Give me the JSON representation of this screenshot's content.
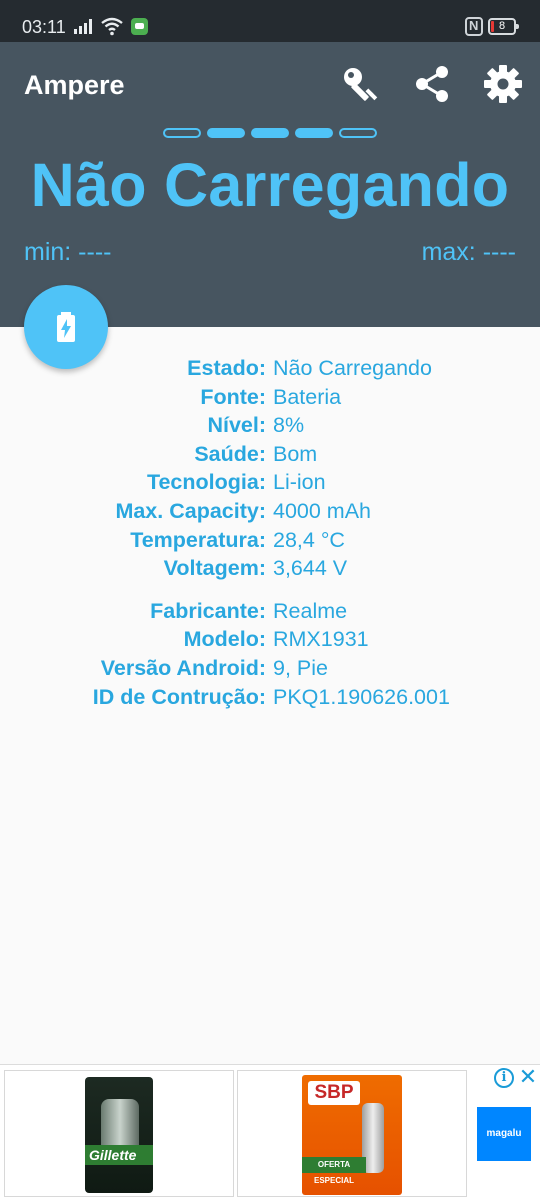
{
  "statusbar": {
    "time": "03:11",
    "battery_level": "8",
    "icons": [
      "signal-icon",
      "wifi-icon",
      "message-icon",
      "nfc-icon",
      "battery-icon"
    ]
  },
  "app": {
    "title": "Ampere",
    "actions": [
      "key-icon",
      "share-icon",
      "settings-gear-icon"
    ],
    "accent_color": "#4fc3f7",
    "header_color": "#475560"
  },
  "pager": {
    "count": 5,
    "active_from": 1,
    "active_to": 3
  },
  "charging": {
    "status": "Não Carregando",
    "min_label": "min: ----",
    "max_label": "max: ----"
  },
  "info": {
    "battery": [
      {
        "key": "Estado:",
        "value": "Não Carregando"
      },
      {
        "key": "Fonte:",
        "value": "Bateria"
      },
      {
        "key": "Nível:",
        "value": "8%"
      },
      {
        "key": "Saúde:",
        "value": "Bom"
      },
      {
        "key": "Tecnologia:",
        "value": "Li-ion"
      },
      {
        "key": "Max. Capacity:",
        "value": "4000 mAh"
      },
      {
        "key": "Temperatura:",
        "value": "28,4 °C"
      },
      {
        "key": "Voltagem:",
        "value": "3,644 V"
      }
    ],
    "device": [
      {
        "key": "Fabricante:",
        "value": "Realme"
      },
      {
        "key": "Modelo:",
        "value": "RMX1931"
      },
      {
        "key": "Versão Android:",
        "value": "9, Pie"
      },
      {
        "key": "ID de Contrução:",
        "value": "PKQ1.190626.001"
      }
    ]
  },
  "ad": {
    "product_1_brand": "Gillette",
    "product_2_brand": "SBP",
    "product_2_tag": "OFERTA ESPECIAL",
    "advertiser": "magalu",
    "info_glyph": "i",
    "close_glyph": "✕"
  }
}
